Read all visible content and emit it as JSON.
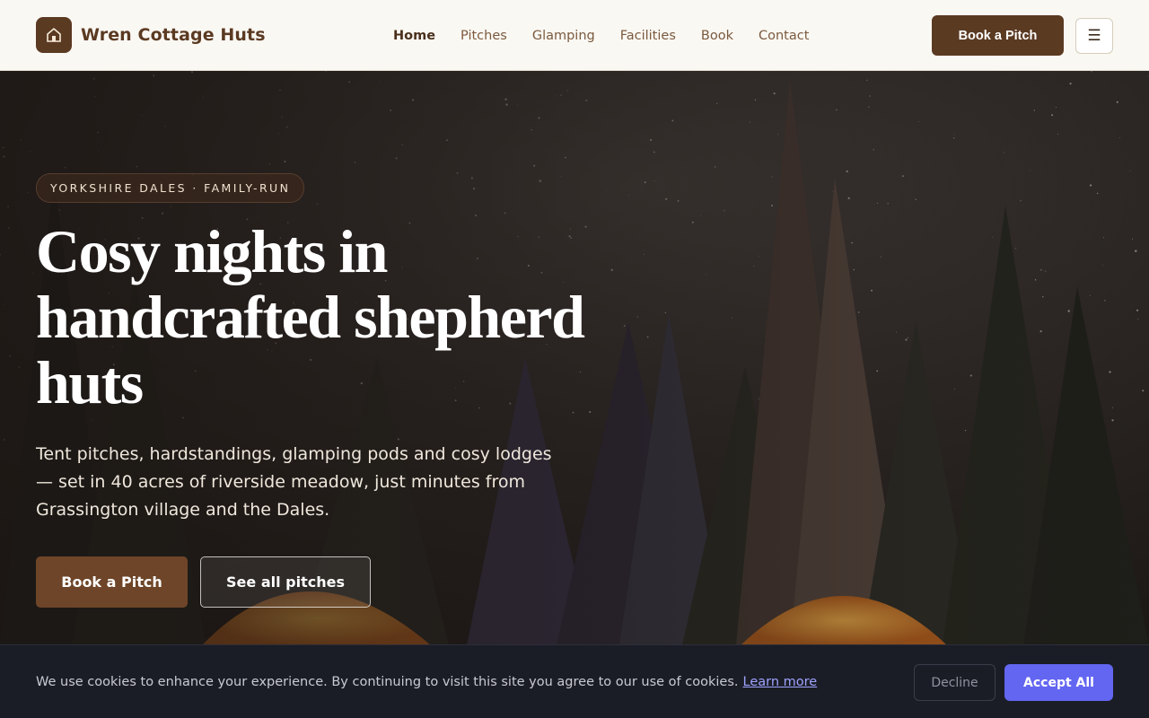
{
  "brand": {
    "icon": "cabin-icon",
    "name": "Wren Cottage Huts"
  },
  "nav": {
    "items": [
      {
        "label": "Home",
        "active": true
      },
      {
        "label": "Pitches",
        "active": false
      },
      {
        "label": "Glamping",
        "active": false
      },
      {
        "label": "Facilities",
        "active": false
      },
      {
        "label": "Book",
        "active": false
      },
      {
        "label": "Contact",
        "active": false
      }
    ]
  },
  "header": {
    "cta_label": "Book a Pitch",
    "menu_icon": "☰"
  },
  "hero": {
    "eyebrow": "YORKSHIRE DALES · FAMILY-RUN",
    "title_lines": [
      "Cosy nights in",
      "handcrafted shepherd",
      "huts"
    ],
    "subtitle": "Tent pitches, hardstandings, glamping pods and cosy lodges — set in 40 acres of riverside meadow, just minutes from Grassington village and the Dales.",
    "primary_label": "Book a Pitch",
    "secondary_label": "See all pitches"
  },
  "cookie": {
    "text": "We use cookies to enhance your experience. By continuing to visit this site you agree to our use of cookies.",
    "link_label": "Learn more",
    "decline_label": "Decline",
    "accept_label": "Accept All"
  },
  "colors": {
    "brand": "#5b3a22",
    "primary": "#6e4528",
    "accept": "#6366f1",
    "cookie_bg": "#1b1d26"
  }
}
